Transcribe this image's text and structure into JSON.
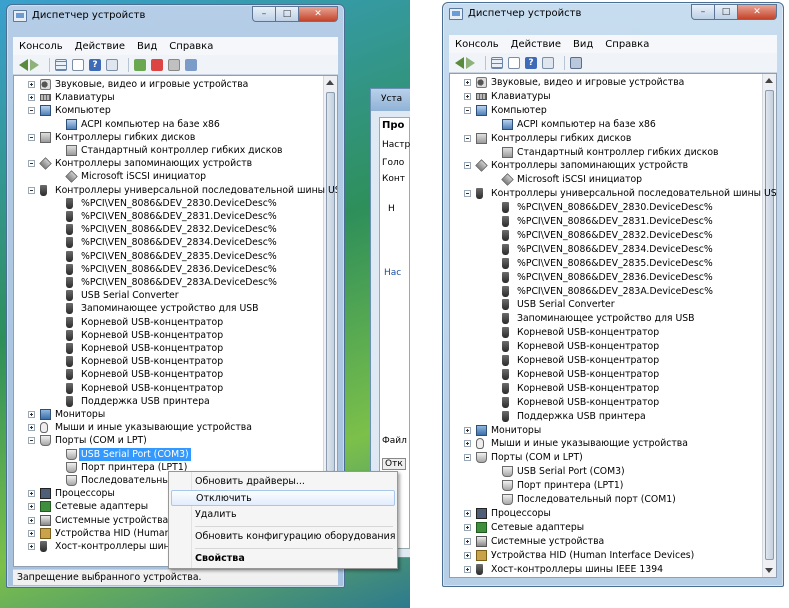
{
  "window_title": "Диспетчер устройств",
  "menu": [
    "Консоль",
    "Действие",
    "Вид",
    "Справка"
  ],
  "left": {
    "tree": [
      {
        "depth": 0,
        "exp": "plus",
        "icon": "speaker-icon",
        "cls": "spk",
        "label": "Звуковые, видео и игровые устройства"
      },
      {
        "depth": 0,
        "exp": "plus",
        "icon": "keyboard-icon",
        "cls": "kbd",
        "label": "Клавиатуры"
      },
      {
        "depth": 0,
        "exp": "minus",
        "icon": "computer-icon",
        "cls": "pc",
        "label": "Компьютер"
      },
      {
        "depth": 1,
        "exp": "",
        "icon": "computer-icon",
        "cls": "pc",
        "label": "ACPI компьютер на базе x86"
      },
      {
        "depth": 0,
        "exp": "minus",
        "icon": "floppy-controller-icon",
        "cls": "disk",
        "label": "Контроллеры гибких дисков"
      },
      {
        "depth": 1,
        "exp": "",
        "icon": "floppy-controller-icon",
        "cls": "disk",
        "label": "Стандартный контроллер гибких дисков"
      },
      {
        "depth": 0,
        "exp": "minus",
        "icon": "storage-controller-icon",
        "cls": "ctrl",
        "label": "Контроллеры запоминающих устройств"
      },
      {
        "depth": 1,
        "exp": "",
        "icon": "storage-controller-icon",
        "cls": "ctrl",
        "label": "Microsoft iSCSI инициатор"
      },
      {
        "depth": 0,
        "exp": "minus",
        "icon": "usb-icon",
        "cls": "usb",
        "label": "Контроллеры универсальной последовательной шины USB"
      },
      {
        "depth": 1,
        "exp": "",
        "icon": "usb-icon",
        "cls": "usb",
        "label": "%PCI\\VEN_8086&DEV_2830.DeviceDesc%"
      },
      {
        "depth": 1,
        "exp": "",
        "icon": "usb-icon",
        "cls": "usb",
        "label": "%PCI\\VEN_8086&DEV_2831.DeviceDesc%"
      },
      {
        "depth": 1,
        "exp": "",
        "icon": "usb-icon",
        "cls": "usb",
        "label": "%PCI\\VEN_8086&DEV_2832.DeviceDesc%"
      },
      {
        "depth": 1,
        "exp": "",
        "icon": "usb-icon",
        "cls": "usb",
        "label": "%PCI\\VEN_8086&DEV_2834.DeviceDesc%"
      },
      {
        "depth": 1,
        "exp": "",
        "icon": "usb-icon",
        "cls": "usb",
        "label": "%PCI\\VEN_8086&DEV_2835.DeviceDesc%"
      },
      {
        "depth": 1,
        "exp": "",
        "icon": "usb-icon",
        "cls": "usb",
        "label": "%PCI\\VEN_8086&DEV_2836.DeviceDesc%"
      },
      {
        "depth": 1,
        "exp": "",
        "icon": "usb-icon",
        "cls": "usb",
        "label": "%PCI\\VEN_8086&DEV_283A.DeviceDesc%"
      },
      {
        "depth": 1,
        "exp": "",
        "icon": "usb-icon",
        "cls": "usb",
        "label": "USB Serial Converter"
      },
      {
        "depth": 1,
        "exp": "",
        "icon": "usb-icon",
        "cls": "usb",
        "label": "Запоминающее устройство для USB"
      },
      {
        "depth": 1,
        "exp": "",
        "icon": "usb-icon",
        "cls": "usb",
        "label": "Корневой USB-концентратор"
      },
      {
        "depth": 1,
        "exp": "",
        "icon": "usb-icon",
        "cls": "usb",
        "label": "Корневой USB-концентратор"
      },
      {
        "depth": 1,
        "exp": "",
        "icon": "usb-icon",
        "cls": "usb",
        "label": "Корневой USB-концентратор"
      },
      {
        "depth": 1,
        "exp": "",
        "icon": "usb-icon",
        "cls": "usb",
        "label": "Корневой USB-концентратор"
      },
      {
        "depth": 1,
        "exp": "",
        "icon": "usb-icon",
        "cls": "usb",
        "label": "Корневой USB-концентратор"
      },
      {
        "depth": 1,
        "exp": "",
        "icon": "usb-icon",
        "cls": "usb",
        "label": "Корневой USB-концентратор"
      },
      {
        "depth": 1,
        "exp": "",
        "icon": "usb-icon",
        "cls": "usb",
        "label": "Поддержка USB принтера"
      },
      {
        "depth": 0,
        "exp": "plus",
        "icon": "monitor-icon",
        "cls": "mon",
        "label": "Мониторы"
      },
      {
        "depth": 0,
        "exp": "plus",
        "icon": "mouse-icon",
        "cls": "mouse",
        "label": "Мыши и иные указывающие устройства"
      },
      {
        "depth": 0,
        "exp": "minus",
        "icon": "port-icon",
        "cls": "port",
        "label": "Порты (COM и LPT)"
      },
      {
        "depth": 1,
        "exp": "",
        "icon": "port-icon",
        "cls": "port",
        "label": "USB Serial Port (COM3)",
        "selected": true
      },
      {
        "depth": 1,
        "exp": "",
        "icon": "port-icon",
        "cls": "port",
        "label": "Порт принтера (LPT1)"
      },
      {
        "depth": 1,
        "exp": "",
        "icon": "port-icon",
        "cls": "port",
        "label": "Последовательный п"
      },
      {
        "depth": 0,
        "exp": "plus",
        "icon": "processor-icon",
        "cls": "cpu",
        "label": "Процессоры"
      },
      {
        "depth": 0,
        "exp": "plus",
        "icon": "network-adapter-icon",
        "cls": "net",
        "label": "Сетевые адаптеры"
      },
      {
        "depth": 0,
        "exp": "plus",
        "icon": "system-device-icon",
        "cls": "sys",
        "label": "Системные устройства"
      },
      {
        "depth": 0,
        "exp": "plus",
        "icon": "hid-icon",
        "cls": "hid",
        "label": "Устройства HID (Human In"
      },
      {
        "depth": 0,
        "exp": "plus",
        "icon": "usb-hub-icon",
        "cls": "usb",
        "label": "Хост-контроллеры шины"
      }
    ],
    "status": "Запрещение выбранного устройства."
  },
  "context_menu": {
    "update": "Обновить драйверы...",
    "disable": "Отключить",
    "remove": "Удалить",
    "scan": "Обновить конфигурацию оборудования",
    "properties": "Свойства"
  },
  "back_dialog": {
    "title": "Уста",
    "heading": "Про",
    "tab1": "Настр",
    "tab2": "Голо",
    "tab3": "Конт",
    "field": "Н",
    "label": "Нас",
    "file_label": "Файл",
    "btn": "Отк"
  },
  "right": {
    "tree": [
      {
        "depth": 0,
        "exp": "plus",
        "icon": "speaker-icon",
        "cls": "spk",
        "label": "Звуковые, видео и игровые устройства"
      },
      {
        "depth": 0,
        "exp": "plus",
        "icon": "keyboard-icon",
        "cls": "kbd",
        "label": "Клавиатуры"
      },
      {
        "depth": 0,
        "exp": "minus",
        "icon": "computer-icon",
        "cls": "pc",
        "label": "Компьютер"
      },
      {
        "depth": 1,
        "exp": "",
        "icon": "computer-icon",
        "cls": "pc",
        "label": "ACPI компьютер на базе x86"
      },
      {
        "depth": 0,
        "exp": "minus",
        "icon": "floppy-controller-icon",
        "cls": "disk",
        "label": "Контроллеры гибких дисков"
      },
      {
        "depth": 1,
        "exp": "",
        "icon": "floppy-controller-icon",
        "cls": "disk",
        "label": "Стандартный контроллер гибких дисков"
      },
      {
        "depth": 0,
        "exp": "minus",
        "icon": "storage-controller-icon",
        "cls": "ctrl",
        "label": "Контроллеры запоминающих устройств"
      },
      {
        "depth": 1,
        "exp": "",
        "icon": "storage-controller-icon",
        "cls": "ctrl",
        "label": "Microsoft iSCSI инициатор"
      },
      {
        "depth": 0,
        "exp": "minus",
        "icon": "usb-icon",
        "cls": "usb",
        "label": "Контроллеры универсальной последовательной шины USB"
      },
      {
        "depth": 1,
        "exp": "",
        "icon": "usb-icon",
        "cls": "usb",
        "label": "%PCI\\VEN_8086&DEV_2830.DeviceDesc%"
      },
      {
        "depth": 1,
        "exp": "",
        "icon": "usb-icon",
        "cls": "usb",
        "label": "%PCI\\VEN_8086&DEV_2831.DeviceDesc%"
      },
      {
        "depth": 1,
        "exp": "",
        "icon": "usb-icon",
        "cls": "usb",
        "label": "%PCI\\VEN_8086&DEV_2832.DeviceDesc%"
      },
      {
        "depth": 1,
        "exp": "",
        "icon": "usb-icon",
        "cls": "usb",
        "label": "%PCI\\VEN_8086&DEV_2834.DeviceDesc%"
      },
      {
        "depth": 1,
        "exp": "",
        "icon": "usb-icon",
        "cls": "usb",
        "label": "%PCI\\VEN_8086&DEV_2835.DeviceDesc%"
      },
      {
        "depth": 1,
        "exp": "",
        "icon": "usb-icon",
        "cls": "usb",
        "label": "%PCI\\VEN_8086&DEV_2836.DeviceDesc%"
      },
      {
        "depth": 1,
        "exp": "",
        "icon": "usb-icon",
        "cls": "usb",
        "label": "%PCI\\VEN_8086&DEV_283A.DeviceDesc%"
      },
      {
        "depth": 1,
        "exp": "",
        "icon": "usb-icon",
        "cls": "usb",
        "label": "USB Serial Converter"
      },
      {
        "depth": 1,
        "exp": "",
        "icon": "usb-icon",
        "cls": "usb",
        "label": "Запоминающее устройство для USB"
      },
      {
        "depth": 1,
        "exp": "",
        "icon": "usb-icon",
        "cls": "usb",
        "label": "Корневой USB-концентратор"
      },
      {
        "depth": 1,
        "exp": "",
        "icon": "usb-icon",
        "cls": "usb",
        "label": "Корневой USB-концентратор"
      },
      {
        "depth": 1,
        "exp": "",
        "icon": "usb-icon",
        "cls": "usb",
        "label": "Корневой USB-концентратор"
      },
      {
        "depth": 1,
        "exp": "",
        "icon": "usb-icon",
        "cls": "usb",
        "label": "Корневой USB-концентратор"
      },
      {
        "depth": 1,
        "exp": "",
        "icon": "usb-icon",
        "cls": "usb",
        "label": "Корневой USB-концентратор"
      },
      {
        "depth": 1,
        "exp": "",
        "icon": "usb-icon",
        "cls": "usb",
        "label": "Корневой USB-концентратор"
      },
      {
        "depth": 1,
        "exp": "",
        "icon": "usb-icon",
        "cls": "usb",
        "label": "Поддержка USB принтера"
      },
      {
        "depth": 0,
        "exp": "plus",
        "icon": "monitor-icon",
        "cls": "mon",
        "label": "Мониторы"
      },
      {
        "depth": 0,
        "exp": "plus",
        "icon": "mouse-icon",
        "cls": "mouse",
        "label": "Мыши и иные указывающие устройства"
      },
      {
        "depth": 0,
        "exp": "minus",
        "icon": "port-icon",
        "cls": "port",
        "label": "Порты (COM и LPT)"
      },
      {
        "depth": 1,
        "exp": "",
        "icon": "port-icon",
        "cls": "port",
        "label": "USB Serial Port (COM3)"
      },
      {
        "depth": 1,
        "exp": "",
        "icon": "port-icon",
        "cls": "port",
        "label": "Порт принтера (LPT1)"
      },
      {
        "depth": 1,
        "exp": "",
        "icon": "port-icon",
        "cls": "port",
        "label": "Последовательный порт (COM1)"
      },
      {
        "depth": 0,
        "exp": "plus",
        "icon": "processor-icon",
        "cls": "cpu",
        "label": "Процессоры"
      },
      {
        "depth": 0,
        "exp": "plus",
        "icon": "network-adapter-icon",
        "cls": "net",
        "label": "Сетевые адаптеры"
      },
      {
        "depth": 0,
        "exp": "plus",
        "icon": "system-device-icon",
        "cls": "sys",
        "label": "Системные устройства"
      },
      {
        "depth": 0,
        "exp": "plus",
        "icon": "hid-icon",
        "cls": "hid",
        "label": "Устройства HID (Human Interface Devices)"
      },
      {
        "depth": 0,
        "exp": "plus",
        "icon": "usb-hub-icon",
        "cls": "usb",
        "label": "Хост-контроллеры шины IEEE 1394"
      }
    ]
  }
}
